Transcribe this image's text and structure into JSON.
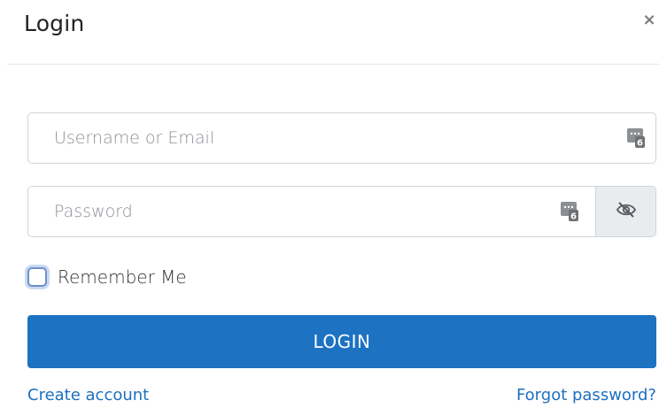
{
  "modal": {
    "title": "Login",
    "close_label": "×"
  },
  "username": {
    "placeholder": "Username or Email",
    "value": "",
    "manager_icon": "password-manager-icon"
  },
  "password": {
    "placeholder": "Password",
    "value": "",
    "manager_icon": "password-manager-icon",
    "toggle_icon": "eye-slash-icon"
  },
  "remember": {
    "label": "Remember Me",
    "checked": false
  },
  "login_button": {
    "label": "LOGIN"
  },
  "links": {
    "create_account": "Create account",
    "forgot_password": "Forgot password?"
  },
  "colors": {
    "primary": "#1d72c2",
    "link": "#1d6fbf",
    "border": "#ced4da",
    "addon_bg": "#e9ecef"
  }
}
